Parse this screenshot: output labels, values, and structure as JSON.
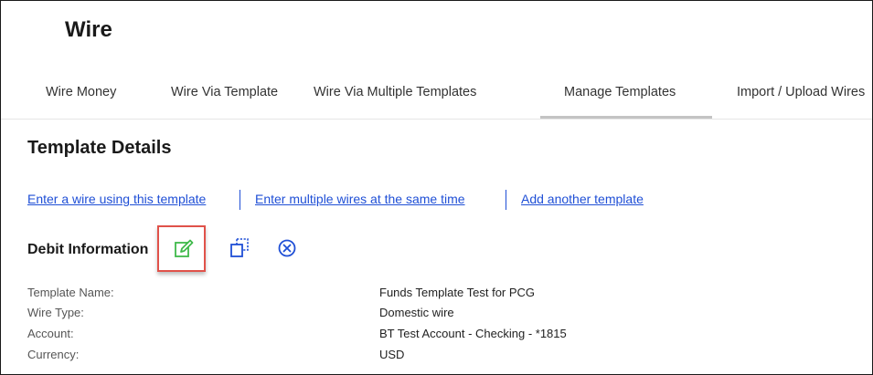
{
  "app": {
    "title": "Wire"
  },
  "tabs": [
    {
      "label": "Wire Money"
    },
    {
      "label": "Wire Via Template"
    },
    {
      "label": "Wire Via Multiple Templates"
    },
    {
      "label": "Manage Templates",
      "active": true
    },
    {
      "label": "Import / Upload Wires"
    }
  ],
  "section": {
    "title": "Template Details"
  },
  "links": [
    {
      "label": "Enter a wire using this template"
    },
    {
      "label": "Enter multiple wires at the same time"
    },
    {
      "label": "Add another template"
    }
  ],
  "debit": {
    "title": "Debit Information",
    "actions": [
      {
        "icon": "edit-icon"
      },
      {
        "icon": "copy-icon"
      },
      {
        "icon": "cancel-circle-icon"
      }
    ]
  },
  "fields": [
    {
      "label": "Template Name:",
      "value": "Funds Template Test for PCG"
    },
    {
      "label": "Wire Type:",
      "value": "Domestic wire"
    },
    {
      "label": "Account:",
      "value": "BT Test Account - Checking - *1815"
    },
    {
      "label": "Currency:",
      "value": "USD"
    }
  ],
  "colors": {
    "link": "#1f4fd6",
    "edit_icon": "#3fb94a",
    "highlight_border": "#e0524a",
    "active_tab_underline": "#c4c4c4"
  }
}
